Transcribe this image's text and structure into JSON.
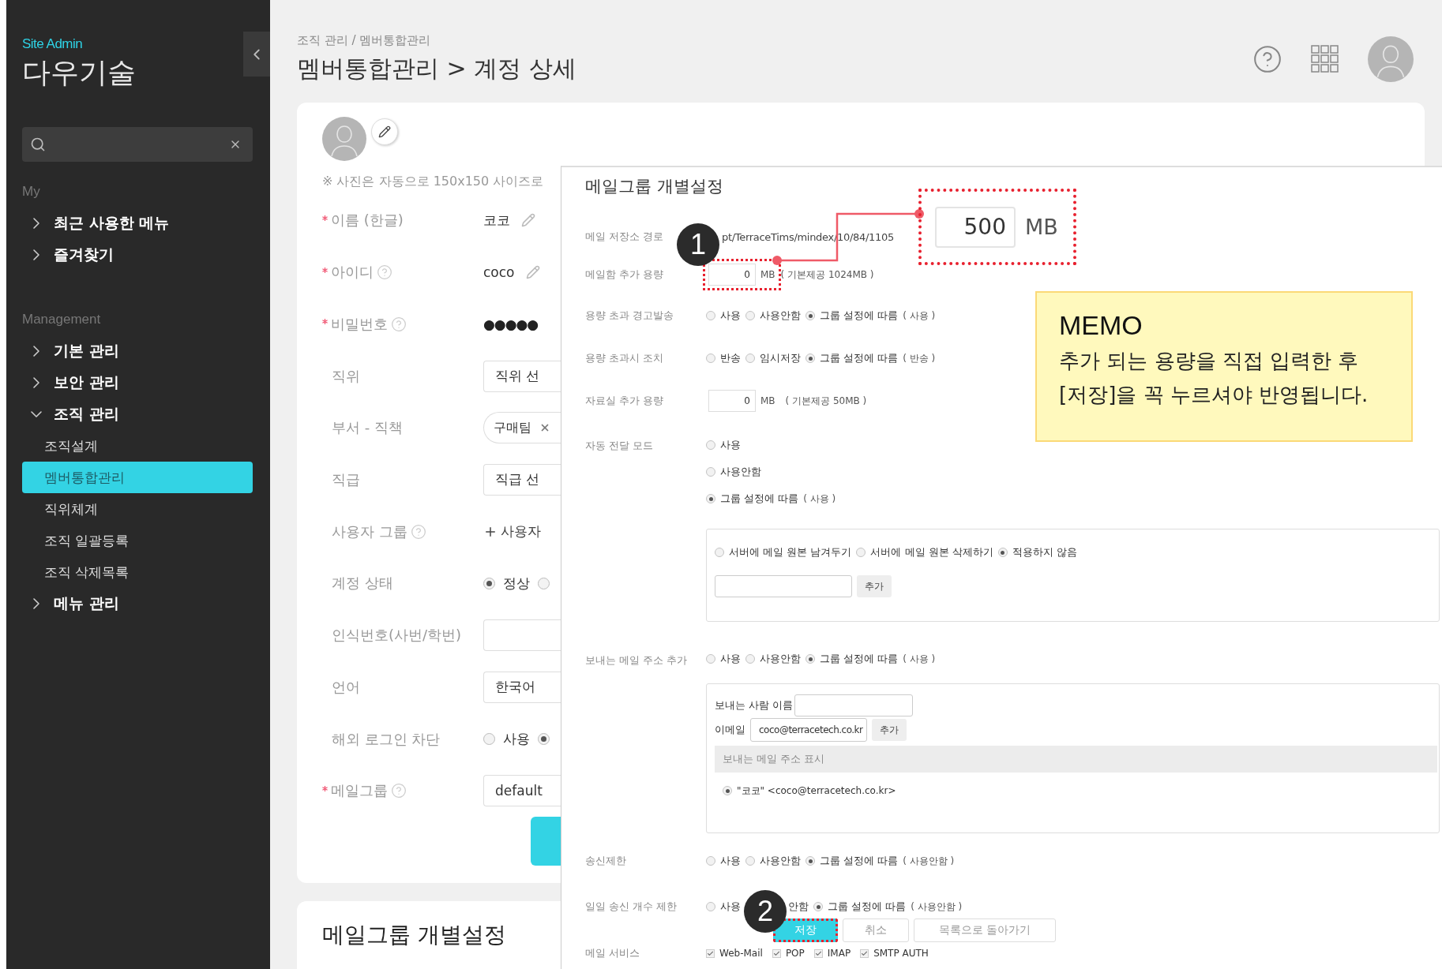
{
  "sidebar": {
    "caption": "Site Admin",
    "brand": "다우기술",
    "sections": [
      {
        "title": "My",
        "items": [
          {
            "label": "최근 사용한 메뉴",
            "expanded": false
          },
          {
            "label": "즐겨찾기",
            "expanded": false
          }
        ]
      },
      {
        "title": "Management",
        "items": [
          {
            "label": "기본 관리",
            "expanded": false
          },
          {
            "label": "보안 관리",
            "expanded": false
          },
          {
            "label": "조직 관리",
            "expanded": true,
            "children": [
              {
                "label": "조직설계",
                "selected": false
              },
              {
                "label": "멤버통합관리",
                "selected": true
              },
              {
                "label": "직위체계",
                "selected": false
              },
              {
                "label": "조직 일괄등록",
                "selected": false
              },
              {
                "label": "조직 삭제목록",
                "selected": false
              }
            ]
          },
          {
            "label": "메뉴 관리",
            "expanded": false
          }
        ]
      }
    ]
  },
  "header": {
    "breadcrumb": "조직 관리 / 멤버통합관리",
    "title": "멤버통합관리 > 계정 상세"
  },
  "profile": {
    "photo_note": "※ 사진은 자동으로 150x150 사이즈로",
    "fields": [
      {
        "label": "이름 (한글)",
        "required": true,
        "help": false,
        "kind": "text",
        "value": "코코"
      },
      {
        "label": "아이디",
        "required": true,
        "help": true,
        "kind": "text",
        "value": "coco"
      },
      {
        "label": "비밀번호",
        "required": true,
        "help": true,
        "kind": "password",
        "value": "●●●●●"
      },
      {
        "label": "직위",
        "required": false,
        "help": false,
        "kind": "select",
        "value": "직위 선"
      },
      {
        "label": "부서 - 직책",
        "required": false,
        "help": false,
        "kind": "tag",
        "value": "구매팀"
      },
      {
        "label": "직급",
        "required": false,
        "help": false,
        "kind": "select",
        "value": "직급 선"
      },
      {
        "label": "사용자 그룹",
        "required": false,
        "help": true,
        "kind": "add",
        "value": "사용자"
      },
      {
        "label": "계정 상태",
        "required": false,
        "help": false,
        "kind": "radio",
        "options": [
          {
            "label": "정상",
            "selected": true
          },
          {
            "selected": false
          }
        ]
      },
      {
        "label": "인식번호(사번/학번)",
        "required": false,
        "help": false,
        "kind": "input"
      },
      {
        "label": "언어",
        "required": false,
        "help": false,
        "kind": "select",
        "value": "한국어"
      },
      {
        "label": "해외 로그인 차단",
        "required": false,
        "help": false,
        "kind": "radio",
        "options": [
          {
            "label": "사용",
            "selected": false
          },
          {
            "selected": true
          }
        ]
      },
      {
        "label": "메일그룹",
        "required": true,
        "help": true,
        "kind": "select",
        "value": "default"
      }
    ]
  },
  "second_card": {
    "title": "메일그룹 개별설정"
  },
  "popup": {
    "title": "메일그룹 개별설정",
    "rows": [
      {
        "kind": "text",
        "label": "메일 저장소 경로",
        "value": "pt/TerraceTims/mindex/10/84/1105"
      },
      {
        "kind": "quota",
        "label": "메일함 추가 용량",
        "value": "0",
        "unit": "MB",
        "note": "( 기본제공 1024MB )",
        "highlighted": true
      },
      {
        "kind": "radio",
        "label": "용량 초과 경고발송",
        "options": [
          {
            "label": "사용",
            "selected": false
          },
          {
            "label": "사용안함",
            "selected": false
          },
          {
            "label": "그룹 설정에 따름",
            "selected": true
          }
        ],
        "note": "( 사용 )"
      },
      {
        "kind": "radio",
        "label": "용량 초과시 조치",
        "options": [
          {
            "label": "반송",
            "selected": false
          },
          {
            "label": "임시저장",
            "selected": false
          },
          {
            "label": "그룹 설정에 따름",
            "selected": true
          }
        ],
        "note": "( 반송 )"
      },
      {
        "kind": "quota",
        "label": "자료실 추가 용량",
        "value": "0",
        "unit": "MB",
        "note": "( 기본제공 50MB )",
        "highlighted": false
      },
      {
        "kind": "forward",
        "label": "자동 전달 모드",
        "options": [
          {
            "label": "사용",
            "selected": false
          },
          {
            "label": "사용안함",
            "selected": false
          },
          {
            "label": "그룹 설정에 따름",
            "selected": true
          }
        ],
        "note": "( 사용 )",
        "box": {
          "options": [
            {
              "label": "서버에 메일 원본 남겨두기",
              "selected": false
            },
            {
              "label": "서버에 메일 원본 삭제하기",
              "selected": false
            },
            {
              "label": "적용하지 않음",
              "selected": true
            }
          ],
          "button": "추가"
        }
      },
      {
        "kind": "sender",
        "label": "보내는 메일 주소 추가",
        "options": [
          {
            "label": "사용",
            "selected": false
          },
          {
            "label": "사용안함",
            "selected": false
          },
          {
            "label": "그룹 설정에 따름",
            "selected": true
          }
        ],
        "note": "( 사용 )",
        "box": {
          "name_label": "보내는 사람 이름",
          "email_label": "이메일",
          "email_value": "coco@terracetech.co.kr",
          "button": "추가",
          "list_header": "보내는 메일 주소 표시",
          "addresses": [
            {
              "label": "\"코코\" <coco@terracetech.co.kr>",
              "selected": true
            }
          ]
        }
      },
      {
        "kind": "radio",
        "label": "송신제한",
        "options": [
          {
            "label": "사용",
            "selected": false
          },
          {
            "label": "사용안함",
            "selected": false
          },
          {
            "label": "그룹 설정에 따름",
            "selected": true
          }
        ],
        "note": "( 사용안함 )"
      },
      {
        "kind": "radio",
        "label": "일일 송신 개수 제한",
        "options": [
          {
            "label": "사용",
            "selected": false
          },
          {
            "label": "안함"
          },
          {
            "label": "그룹 설정에 따름",
            "selected": true
          }
        ],
        "note": "( 사용안함 )"
      },
      {
        "kind": "buttons",
        "buttons": [
          {
            "label": "저장",
            "kind": "primary",
            "highlighted": true
          },
          {
            "label": "취소",
            "kind": "default",
            "highlighted": false
          },
          {
            "label": "목록으로 돌아가기",
            "kind": "default",
            "highlighted": false
          }
        ]
      },
      {
        "kind": "checks",
        "label": "메일 서비스",
        "options": [
          {
            "label": "Web-Mail",
            "checked": true
          },
          {
            "label": "POP",
            "checked": true
          },
          {
            "label": "IMAP",
            "checked": true
          },
          {
            "label": "SMTP AUTH",
            "checked": true
          }
        ]
      }
    ]
  },
  "annotations": {
    "badges": [
      "1",
      "2"
    ],
    "callout": {
      "value": "500",
      "unit": "MB"
    },
    "memo": {
      "title": "MEMO",
      "lines": [
        "추가 되는 용량을 직접 입력한 후",
        "[저장]을 꼭 누르셔야 반영됩니다."
      ]
    }
  }
}
